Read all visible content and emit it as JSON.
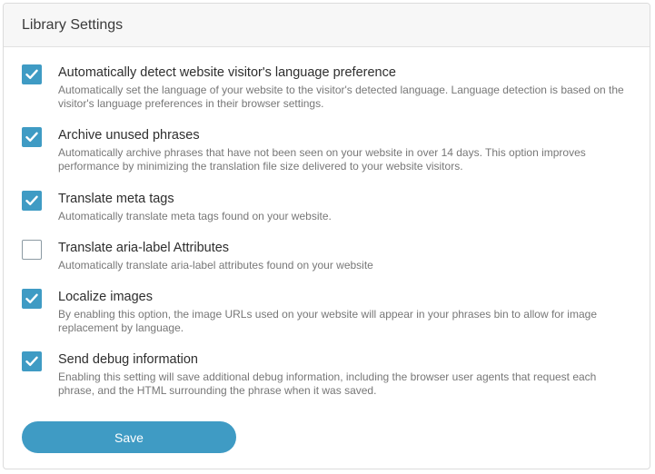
{
  "panel": {
    "title": "Library Settings"
  },
  "settings": [
    {
      "title": "Automatically detect website visitor's language preference",
      "description": "Automatically set the language of your website to the visitor's detected language. Language detection is based on the visitor's language preferences in their browser settings.",
      "checked": true
    },
    {
      "title": "Archive unused phrases",
      "description": "Automatically archive phrases that have not been seen on your website in over 14 days. This option improves performance by minimizing the translation file size delivered to your website visitors.",
      "checked": true
    },
    {
      "title": "Translate meta tags",
      "description": "Automatically translate meta tags found on your website.",
      "checked": true
    },
    {
      "title": "Translate aria-label Attributes",
      "description": "Automatically translate aria-label attributes found on your website",
      "checked": false
    },
    {
      "title": "Localize images",
      "description": "By enabling this option, the image URLs used on your website will appear in your phrases bin to allow for image replacement by language.",
      "checked": true
    },
    {
      "title": "Send debug information",
      "description": "Enabling this setting will save additional debug information, including the browser user agents that request each phrase, and the HTML surrounding the phrase when it was saved.",
      "checked": true
    }
  ],
  "actions": {
    "save_label": "Save"
  },
  "colors": {
    "accent": "#3f9bc4",
    "header_bg": "#f7f7f7",
    "title_text": "#2e2e2e",
    "description_text": "#777777"
  }
}
